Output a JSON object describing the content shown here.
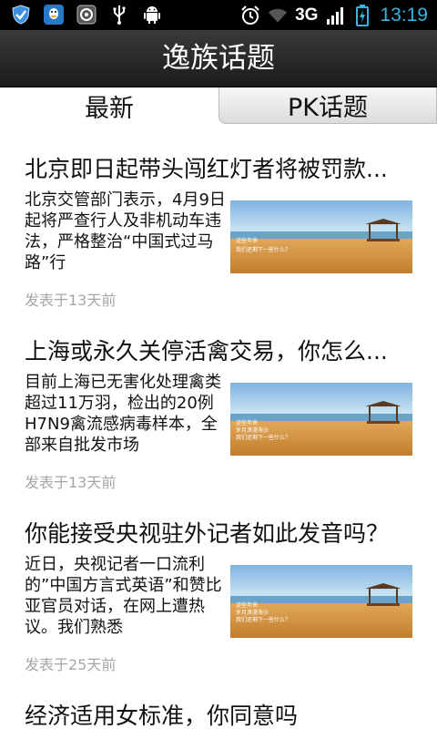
{
  "status_bar": {
    "time": "13:19",
    "network": "3G",
    "left_icons": [
      "shield-icon",
      "qq-penguin-icon",
      "badge-icon",
      "usb-icon",
      "android-icon"
    ],
    "right_icons": [
      "alarm-icon",
      "wifi-icon",
      "signal-icon",
      "battery-charging-icon"
    ],
    "accent_color": "#33b5e5"
  },
  "header": {
    "title": "逸族话题"
  },
  "tabs": [
    {
      "label": "最新",
      "selected": true
    },
    {
      "label": "PK话题",
      "selected": false
    }
  ],
  "articles": [
    {
      "title": "北京即日起带头闯红灯者将被罚款...",
      "summary": "北京交管部门表示，4月9日起将严查行人及非机动车违法，严格整治“中国式过马路”行",
      "thumb_lines": [
        "这些年来",
        "我们还剩下一些什么？"
      ],
      "date": "发表于13天前"
    },
    {
      "title": "上海或永久关停活禽交易，你怎么...",
      "summary": "目前上海已无害化处理禽类超过11万羽，检出的20例H7N9禽流感病毒样本，全部来自批发市场",
      "thumb_lines": [
        "这些年来",
        "岁月浪漫海沙",
        "我们还剩下一些什么？"
      ],
      "date": "发表于13天前"
    },
    {
      "title": "你能接受央视驻外记者如此发音吗？",
      "summary": "近日，央视记者一口流利的”中国方言式英语”和赞比亚官员对话，在网上遭热议。我们熟悉",
      "thumb_lines": [
        "这些年来",
        "岁月浪漫海沙",
        "我们还剩下一些什么？"
      ],
      "date": "发表于25天前"
    },
    {
      "title": "经济适用女标准，你同意吗"
    }
  ]
}
